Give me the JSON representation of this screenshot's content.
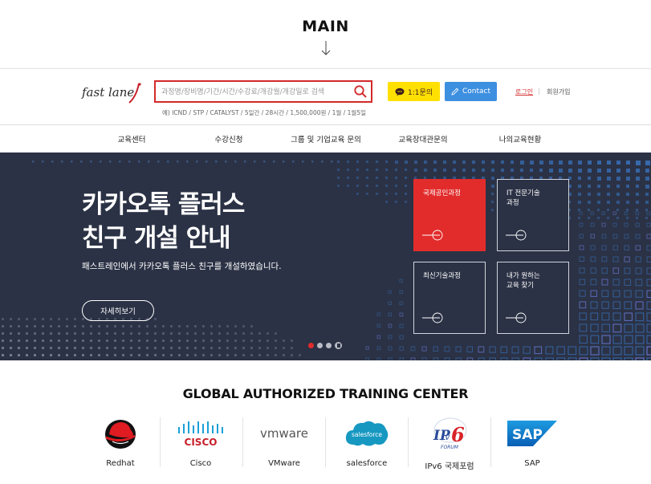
{
  "caption": {
    "title": "MAIN",
    "arrow_icon": "arrow-down-icon"
  },
  "header": {
    "logo_text": "fast lane",
    "search": {
      "placeholder": "과정명/장비명/기간/시간/수강료/개강월/개강일로 검색",
      "hint": "예) ICND / STP / CATALYST / 5일간 / 28시간 / 1,500,000원 / 1월 / 1월5일"
    },
    "kakao_label": "1:1문의",
    "contact_label": "Contact",
    "login_label": "로그인",
    "join_label": "회원가입",
    "separator": "|"
  },
  "nav": {
    "items": [
      "교육센터",
      "수강신청",
      "그룹 및 기업교육 문의",
      "교육장대관문의",
      "나의교육현황"
    ]
  },
  "hero": {
    "title_line1": "카카오톡 플러스",
    "title_line2": "친구 개설 안내",
    "subtitle": "패스트레인에서 카카오톡 플러스 친구를 개설하였습니다.",
    "button_label": "자세히보기",
    "tiles": [
      "국제공인과정",
      "IT 전문기술\n과정",
      "최신기술과정",
      "내가 원하는\n교육 찾기"
    ],
    "slide_count": 3,
    "active_slide": 1,
    "colors": {
      "background": "#2b3245",
      "accent": "#e22c2c"
    }
  },
  "partners": {
    "title": "GLOBAL AUTHORIZED TRAINING CENTER",
    "items": [
      {
        "name": "Redhat",
        "icon": "redhat-logo-icon"
      },
      {
        "name": "Cisco",
        "icon": "cisco-logo-icon",
        "logo_text": "CISCO"
      },
      {
        "name": "VMware",
        "icon": "vmware-logo-icon",
        "logo_text": "vmware"
      },
      {
        "name": "salesforce",
        "icon": "salesforce-logo-icon",
        "logo_text": "salesforce"
      },
      {
        "name": "IPv6 국제포럼",
        "icon": "ipv6-forum-logo-icon",
        "logo_text": "IPv6 FORUM"
      },
      {
        "name": "SAP",
        "icon": "sap-logo-icon",
        "logo_text": "SAP"
      }
    ]
  }
}
